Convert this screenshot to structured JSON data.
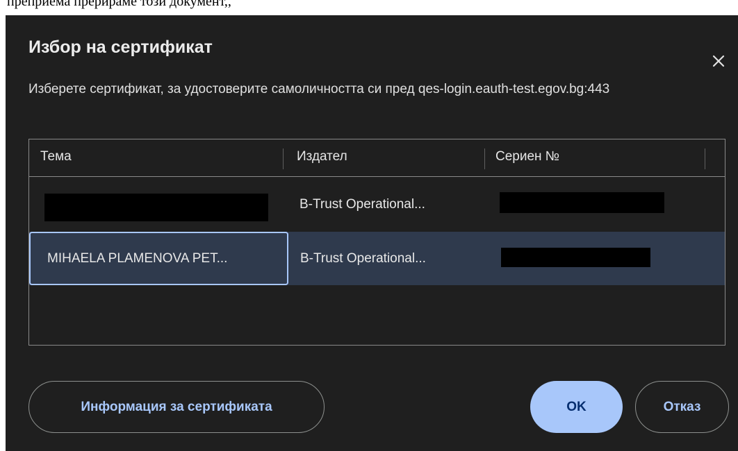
{
  "background_caption": "преприема прерираме този документ,,",
  "dialog": {
    "title": "Избор на сертификат",
    "description": "Изберете сертификат, за удостоверите самоличността си пред qes-login.eauth-test.egov.bg:443",
    "close_icon": "close-icon"
  },
  "table": {
    "columns": [
      "Тема",
      "Издател",
      "Сериен №"
    ],
    "rows": [
      {
        "subject": "",
        "issuer": "B-Trust Operational...",
        "serial": "",
        "subject_redacted": true,
        "serial_redacted": true,
        "selected": false
      },
      {
        "subject": "MIHAELA PLAMENOVA PET...",
        "issuer": "B-Trust Operational...",
        "serial": "",
        "subject_redacted": false,
        "serial_redacted": true,
        "selected": true
      }
    ]
  },
  "buttons": {
    "info": "Информация за сертификата",
    "ok": "OK",
    "cancel": "Отказ"
  },
  "colors": {
    "dialog_bg": "#1f1f1f",
    "selected_row": "#2f3a4d",
    "accent": "#a8c7fa",
    "primary_text_on_accent": "#062e6f"
  }
}
